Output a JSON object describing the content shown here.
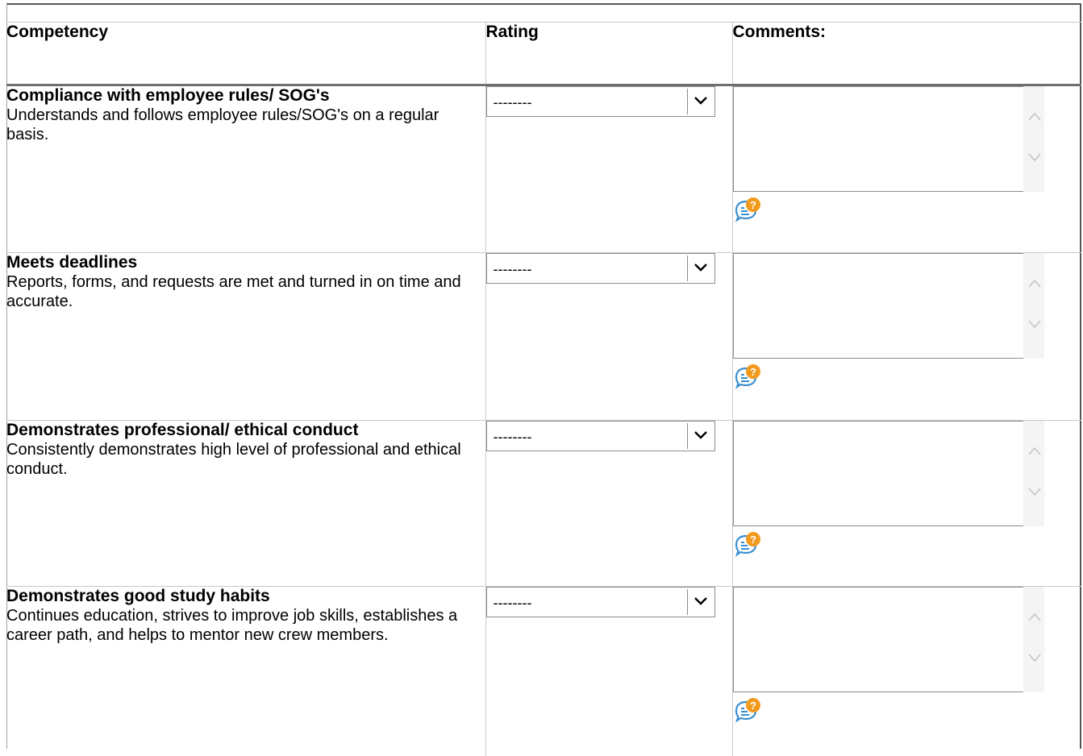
{
  "table": {
    "headers": {
      "competency": "Competency",
      "rating": "Rating",
      "comments": "Comments:"
    },
    "rows": [
      {
        "title": "Compliance with employee rules/ SOG's",
        "description": "Understands and follows employee rules/SOG's on a regular basis.",
        "rating": "--------",
        "comment": ""
      },
      {
        "title": "Meets deadlines",
        "description": "Reports, forms, and requests are met and turned in on time and accurate.",
        "rating": "--------",
        "comment": ""
      },
      {
        "title": "Demonstrates professional/ ethical conduct",
        "description": "Consistently demonstrates high level of professional and ethical conduct.",
        "rating": "--------",
        "comment": ""
      },
      {
        "title": "Demonstrates good study habits",
        "description": "Continues education, strives to improve job skills, establishes a career path, and helps to mentor new crew members.",
        "rating": "--------",
        "comment": ""
      }
    ]
  },
  "icons": {
    "dropdown": "chevron-down-icon",
    "scroll_up": "chevron-up-icon",
    "scroll_down": "chevron-down-icon",
    "help": "comment-help-icon"
  },
  "colors": {
    "help_bubble_blue": "#3a8fd0",
    "help_badge_orange": "#f29a1e",
    "border": "#c8c8c8",
    "header_rule": "#6e6e6e"
  }
}
